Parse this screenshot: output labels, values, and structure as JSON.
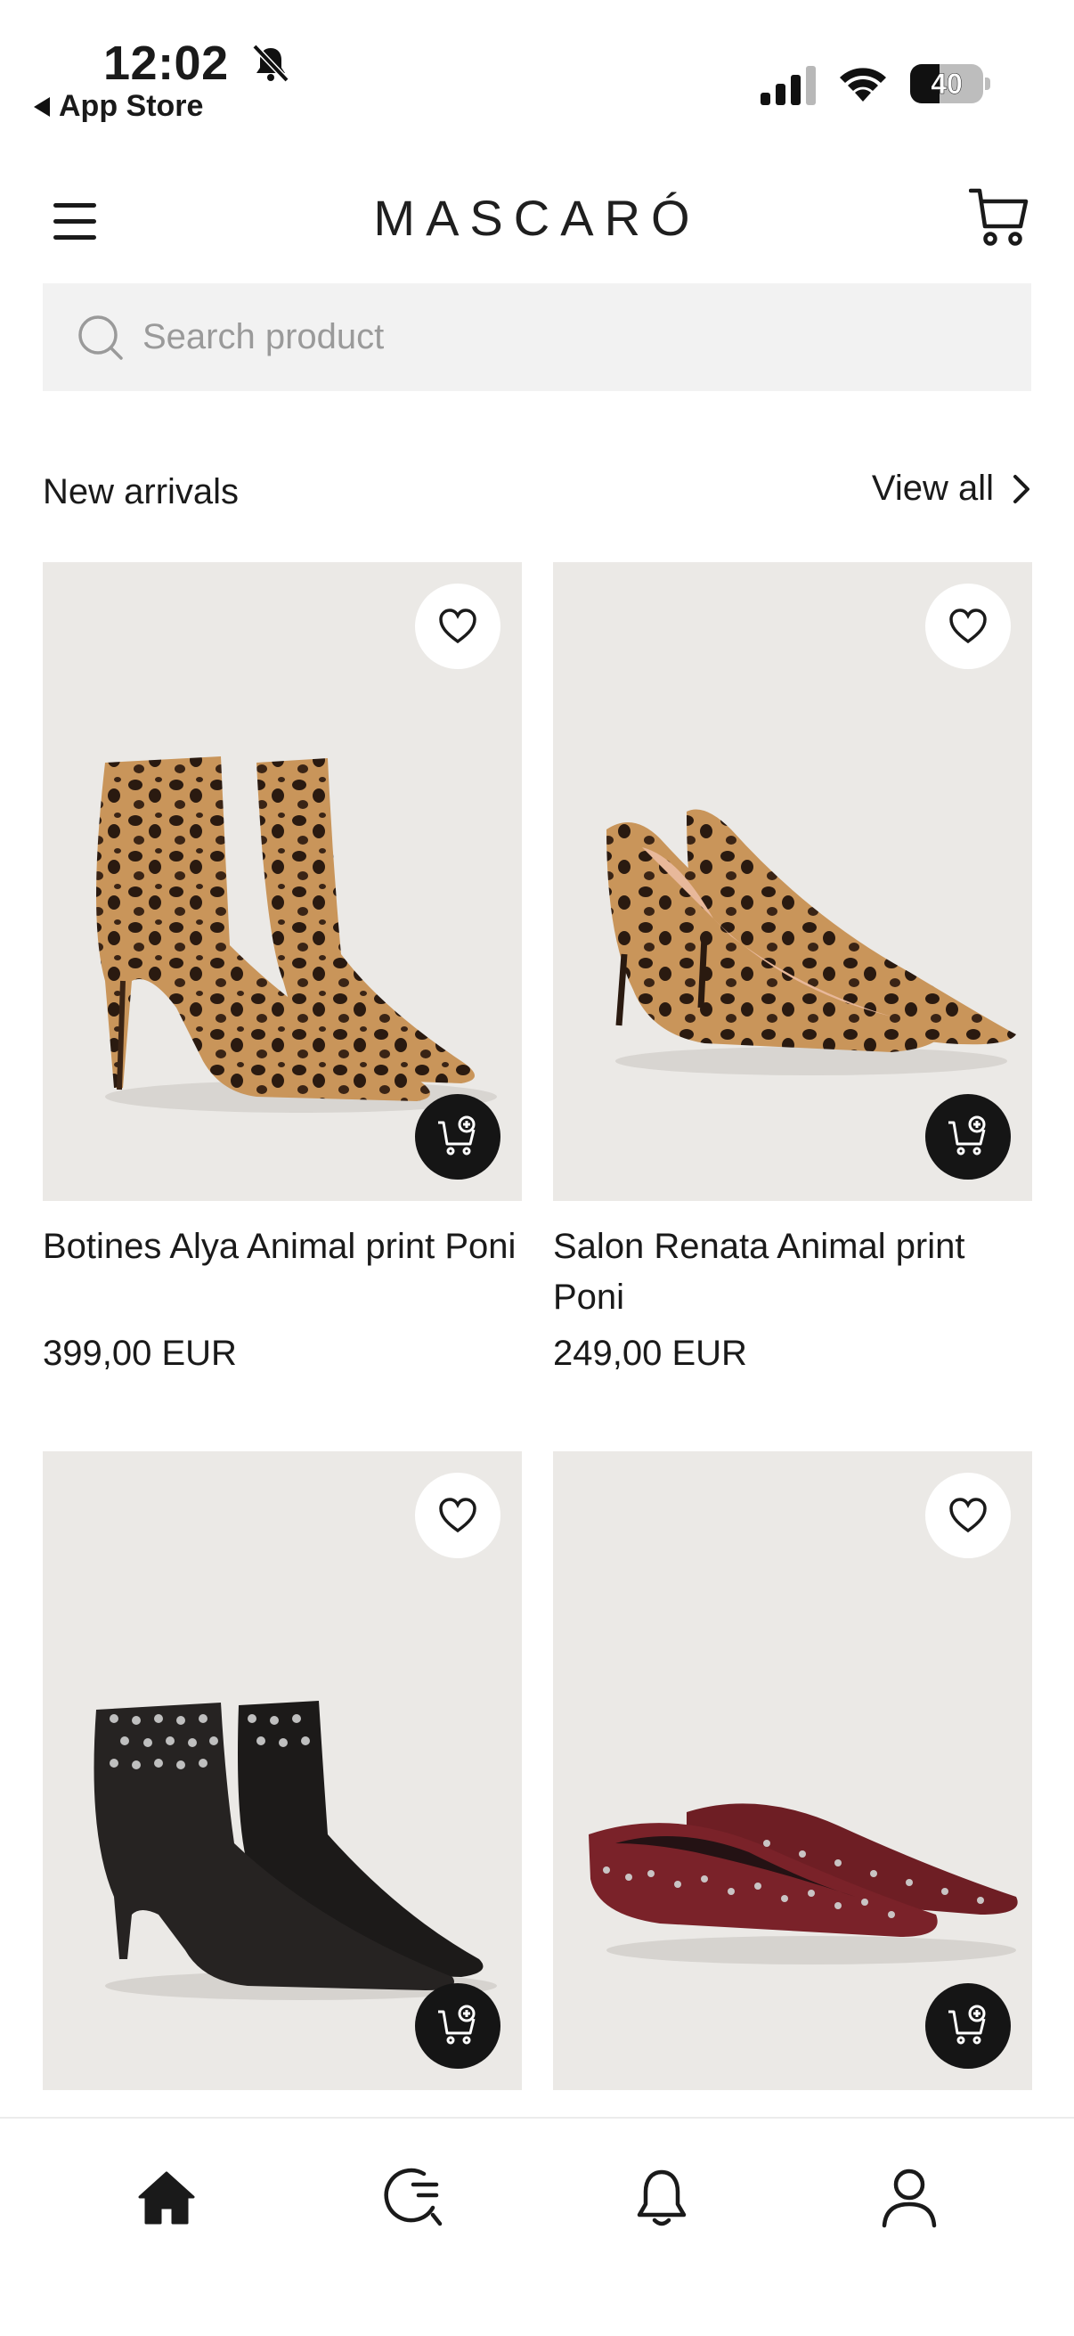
{
  "status_bar": {
    "time": "12:02",
    "back_label": "App Store",
    "battery_level": "40",
    "battery_fraction": 0.4
  },
  "header": {
    "logo": "MASCARÓ",
    "menu_icon": "hamburger-icon",
    "cart_icon": "cart-icon"
  },
  "search": {
    "placeholder": "Search product",
    "icon": "search-icon"
  },
  "section": {
    "title": "New arrivals",
    "view_all_label": "View all"
  },
  "products": [
    {
      "name": "Botines Alya Animal print Poni",
      "price": "399,00 EUR",
      "image": "leopard-ankle-boots"
    },
    {
      "name": "Salon Renata Animal print Poni",
      "price": "249,00 EUR",
      "image": "leopard-pumps"
    },
    {
      "name": "",
      "price": "",
      "image": "black-studded-ankle-boots"
    },
    {
      "name": "",
      "price": "",
      "image": "burgundy-studded-flats"
    }
  ],
  "bottom_nav": {
    "items": [
      {
        "icon": "home-icon",
        "active": true
      },
      {
        "icon": "search-history-icon",
        "active": false
      },
      {
        "icon": "bell-icon",
        "active": false
      },
      {
        "icon": "profile-icon",
        "active": false
      }
    ]
  },
  "colors": {
    "text": "#1a1a1a",
    "search_bg": "#f2f2f2",
    "product_bg": "#ebe9e6",
    "add_button": "#151515"
  }
}
